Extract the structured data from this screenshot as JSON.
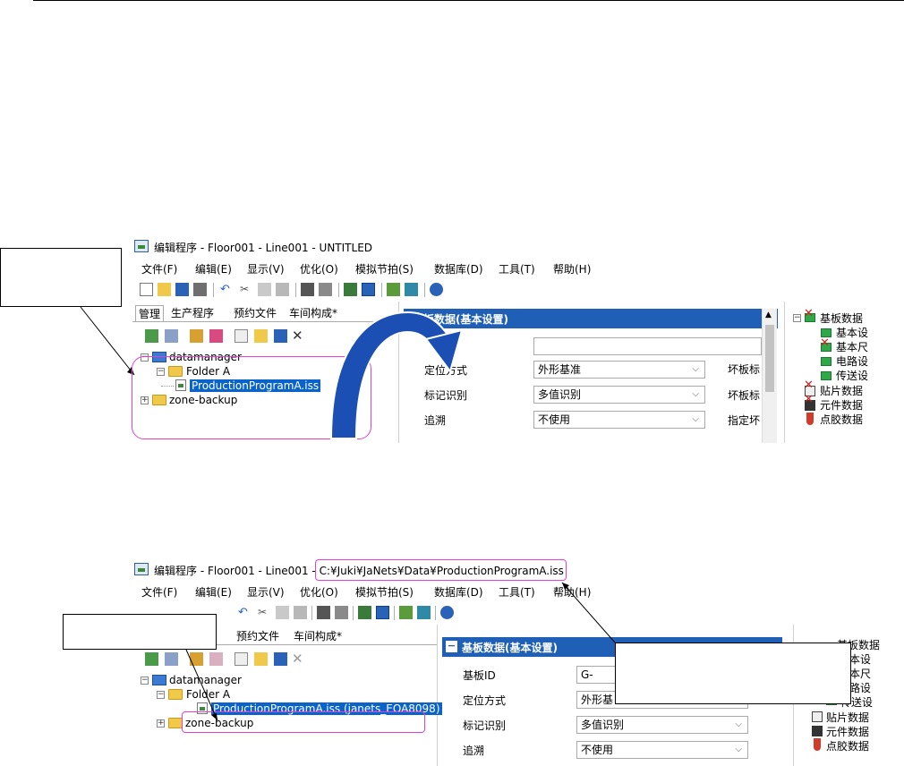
{
  "before": {
    "title": "编辑程序 - Floor001 - Line001 - UNTITLED",
    "menu": [
      "文件(F)",
      "编辑(E)",
      "显示(V)",
      "优化(O)",
      "模拟节拍(S)",
      "数据库(D)",
      "工具(T)",
      "帮助(H)"
    ],
    "tabs": [
      "管理",
      "生产程序",
      "预约文件",
      "车间构成*"
    ],
    "tree": {
      "root": "datamanager",
      "folder": "Folder A",
      "file": "ProductionProgramA.iss",
      "backup": "zone-backup"
    },
    "panel_title": "板数据(基本设置)",
    "fields": [
      {
        "label": "定位方式",
        "value": "外形基准"
      },
      {
        "label": "标记识别",
        "value": "多值识别"
      },
      {
        "label": "追溯",
        "value": "不使用"
      }
    ],
    "side_fields": [
      "坏板标",
      "坏板标",
      "指定坏"
    ],
    "right_tree": {
      "root": "基板数据",
      "children": [
        "基本设",
        "基本尺",
        "电路设",
        "传送设"
      ],
      "others": [
        "贴片数据",
        "元件数据",
        "点胶数据"
      ]
    }
  },
  "after": {
    "title_prefix": "编辑程序 - Floor001 - Line001 - ",
    "title_path": "C:¥Juki¥JaNets¥Data¥ProductionProgramA.iss",
    "menu": [
      "文件(F)",
      "编辑(E)",
      "显示(V)",
      "优化(O)",
      "模拟节拍(S)",
      "数据库(D)",
      "工具(T)",
      "帮助(H)"
    ],
    "tabs": [
      "预约文件",
      "车间构成*"
    ],
    "tree": {
      "root": "datamanager",
      "folder": "Folder A",
      "file": "ProductionProgramA.iss (janets_EOA8098)",
      "backup": "zone-backup"
    },
    "panel_title": "基板数据(基本设置)",
    "fields": [
      {
        "label": "基板ID",
        "value": "G-"
      },
      {
        "label": "定位方式",
        "value": "外形基"
      },
      {
        "label": "标记识别",
        "value": "多值识别"
      },
      {
        "label": "追溯",
        "value": "不使用"
      }
    ],
    "right_tree": {
      "root": "基板数据",
      "children": [
        "本设",
        "本尺",
        "路设",
        "传送设"
      ],
      "others": [
        "贴片数据",
        "元件数据",
        "点胶数据"
      ]
    }
  },
  "colors": {
    "highlight": "#e040d8",
    "arrow": "#1b4fb3",
    "selection": "#0a63c9",
    "panel_header": "#1f5fb5"
  }
}
